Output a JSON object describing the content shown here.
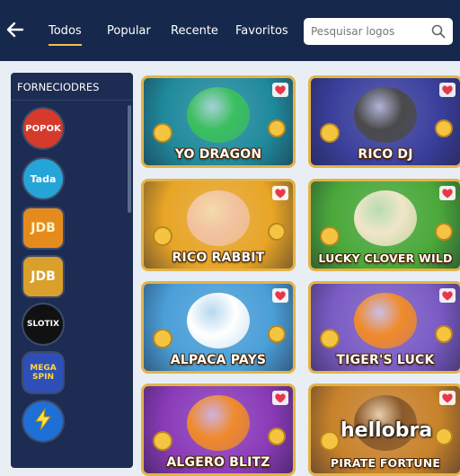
{
  "header": {
    "tabs": [
      {
        "label": "Todos",
        "active": true
      },
      {
        "label": "Popular",
        "active": false
      },
      {
        "label": "Recente",
        "active": false
      },
      {
        "label": "Favoritos",
        "active": false
      }
    ],
    "search": {
      "placeholder": "Pesquisar logos",
      "value": ""
    }
  },
  "sidebar": {
    "title": "FORNECIODRES",
    "providers": [
      {
        "name": "POPOK",
        "bg": "#d63a2a",
        "fg": "#ffffff"
      },
      {
        "name": "Tada",
        "bg": "#25a4d8",
        "fg": "#ffffff"
      },
      {
        "name": "JDB",
        "bg": "#e58b1e",
        "fg": "#fff3c4"
      },
      {
        "name": "JDB",
        "bg": "#d9a02b",
        "fg": "#ffffff"
      },
      {
        "name": "SLOTIX",
        "bg": "#111111",
        "fg": "#ffffff"
      },
      {
        "name": "MEGA SPIN",
        "bg": "#2f4fb8",
        "fg": "#ffd93a"
      },
      {
        "name": "",
        "bg": "#1e6fd6",
        "fg": "#ffe14a",
        "icon": "lightning-bolt-icon"
      }
    ]
  },
  "games": [
    {
      "title": "YO DRAGON",
      "bg": "#1f8a9c",
      "accent": "#3bbf5e",
      "favorite": true
    },
    {
      "title": "RICO DJ",
      "bg": "#3a3f9c",
      "accent": "#4a4a4a",
      "favorite": true
    },
    {
      "title": "RICO RABBIT",
      "bg": "#e8a526",
      "accent": "#f2c2a0",
      "favorite": true
    },
    {
      "title": "LUCKY CLOVER WILD",
      "bg": "#4aa83a",
      "accent": "#f0e6c8",
      "favorite": true
    },
    {
      "title": "ALPACA PAYS",
      "bg": "#4a9fd8",
      "accent": "#ffffff",
      "favorite": true
    },
    {
      "title": "TIGER'S LUCK",
      "bg": "#7a5bc4",
      "accent": "#f08a2a",
      "favorite": true
    },
    {
      "title": "ALGERO BLITZ",
      "bg": "#8a3ab8",
      "accent": "#f08a2a",
      "favorite": true
    },
    {
      "title": "PIRATE FORTUNE",
      "bg": "#c8822a",
      "accent": "#8a5a2a",
      "favorite": true
    }
  ],
  "watermark": "hellobra",
  "colors": {
    "header": "#16284c",
    "sidebar": "#1c2c52",
    "accent": "#f2c14e",
    "card_border": "#e3b347",
    "favorite": "#e8374a"
  }
}
